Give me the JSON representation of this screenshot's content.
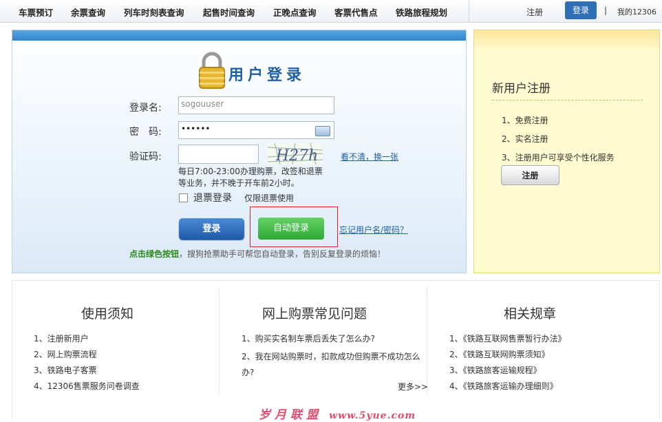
{
  "nav": {
    "items": [
      "车票预订",
      "余票查询",
      "列车时刻表查询",
      "起售时间查询",
      "正晚点查询",
      "客票代售点",
      "铁路旅程规划"
    ],
    "register": "注册",
    "login": "登录",
    "separator": "|",
    "my12306": "我的12306"
  },
  "login": {
    "title": "用户登录",
    "username_label": "登录名:",
    "username_value": "sogouuser",
    "password_label": "密　码:",
    "password_value": "••••••",
    "captcha_label": "验证码:",
    "captcha_value": "",
    "captcha_text": "H27h",
    "captcha_refresh": "看不清，换一张",
    "notice": "每日7:00-23:00办理购票，改签和退票等业务，并不晚于开车前2小时。",
    "refund_label": "退票登录",
    "refund_note": "仅限退票使用",
    "login_button": "登录",
    "auto_login_button": "自动登录",
    "forgot_link": "忘记用户名/密码？",
    "hint_bold": "点击绿色按钮",
    "hint_text": "，搜狗抢票助手可帮您自动登录，告别反复登录的烦恼！"
  },
  "register": {
    "title": "新用户注册",
    "items": [
      "1、免费注册",
      "2、实名注册",
      "3、注册用户可享受个性化服务"
    ],
    "button": "注册"
  },
  "info": {
    "columns": [
      {
        "title": "使用须知",
        "items": [
          "1、注册新用户",
          "2、网上购票流程",
          "3、铁路电子客票",
          "4、12306售票服务问卷调查"
        ]
      },
      {
        "title": "网上购票常见问题",
        "items": [
          "1、购买实名制车票后丢失了怎么办?",
          "2、我在网站购票时，扣款成功但购票不成功怎么办?"
        ],
        "more": "更多>>"
      },
      {
        "title": "相关规章",
        "items": [
          "1、《铁路互联网售票暂行办法》",
          "2、《铁路互联网购票须知》",
          "3、《铁路旅客运输规程》",
          "4、《铁路旅客运输办理细则》"
        ]
      }
    ]
  },
  "watermark": {
    "text": "岁月联盟",
    "url": "www.5yue.com"
  },
  "colors": {
    "primary": "#1f5fa8",
    "green": "#2ea833",
    "highlight": "#d62222",
    "register_bg": "#fffbd0"
  }
}
